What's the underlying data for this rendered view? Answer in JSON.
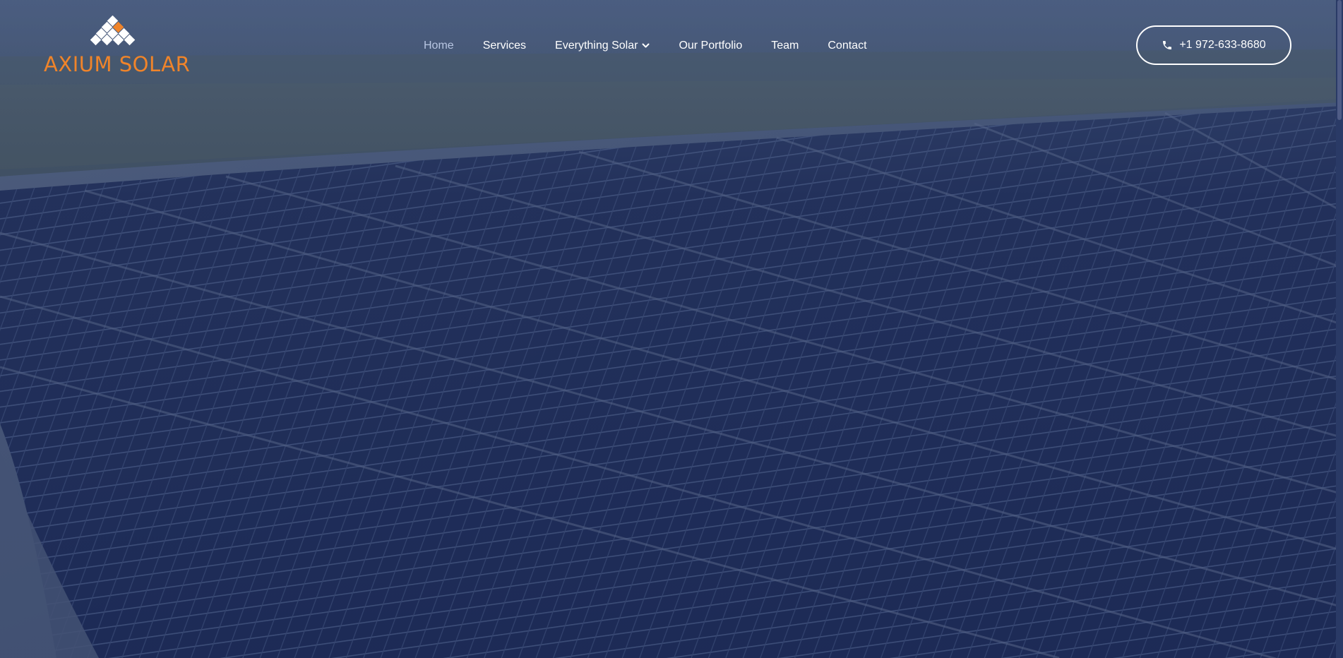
{
  "brand": {
    "name": "AXIUM SOLAR",
    "color": "#f0842a"
  },
  "nav": {
    "items": [
      {
        "label": "Home",
        "active": true
      },
      {
        "label": "Services",
        "active": false
      },
      {
        "label": "Everything Solar",
        "active": false,
        "has_dropdown": true
      },
      {
        "label": "Our Portfolio",
        "active": false
      },
      {
        "label": "Team",
        "active": false
      },
      {
        "label": "Contact",
        "active": false
      }
    ]
  },
  "cta": {
    "phone": "+1 972-633-8680",
    "icon": "phone-icon"
  },
  "hero": {
    "image": "aerial-solar-farm-photo",
    "overlay_color": "#1c2a4e"
  }
}
